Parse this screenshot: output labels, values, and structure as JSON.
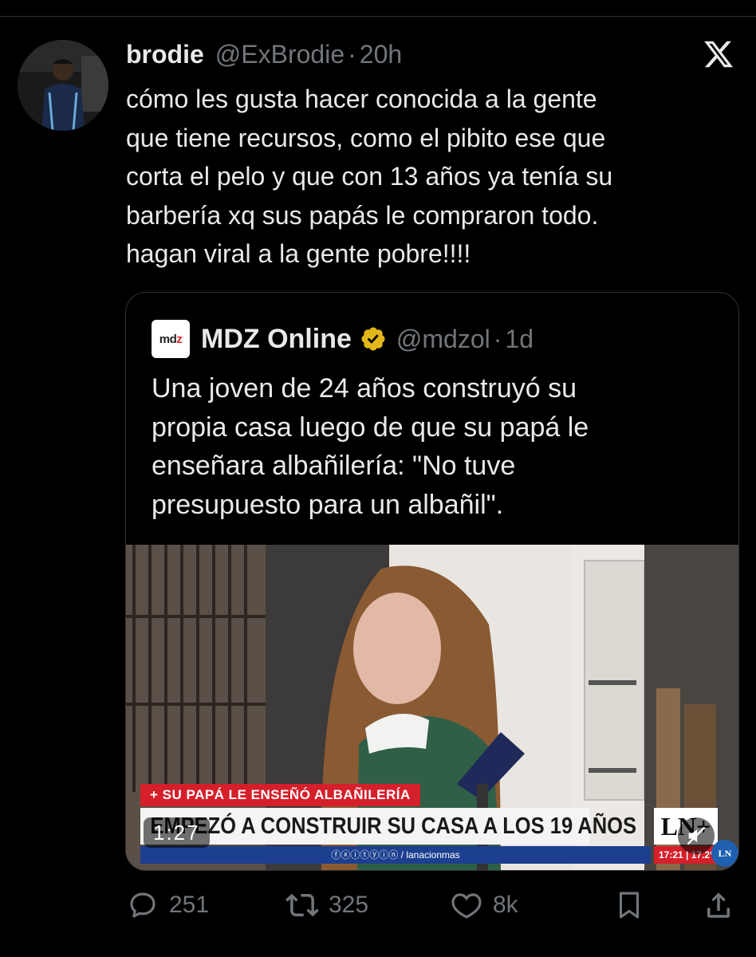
{
  "tweet": {
    "display_name": "brodie",
    "handle": "@ExBrodie",
    "separator": "·",
    "time": "20h",
    "text_lines": [
      "cómo les gusta hacer conocida a la gente",
      "que tiene recursos, como el pibito ese que",
      "corta el pelo y que con 13 años ya tenía su",
      "barbería xq sus papás le compraron todo.",
      "hagan viral a la gente pobre!!!!"
    ]
  },
  "quote": {
    "logo_text": "mdz",
    "display_name": "MDZ Online",
    "verified": "gold-verified-badge",
    "handle": "@mdzol",
    "separator": "·",
    "time": "1d",
    "text_lines": [
      "Una joven de 24 años construyó su",
      "propia casa luego de que su papá le",
      "enseñara albañilería: \"No tuve",
      "presupuesto para un albañil\"."
    ],
    "video": {
      "tag": "+ SU PAPÁ LE ENSEÑÓ ALBAÑILERÍA",
      "headline": "EMPEZÓ A CONSTRUIR SU CASA A LOS 19 AÑOS",
      "channel_badge": "LN+",
      "social_handle": "ⓕⓧⓘⓣⓨⓘⓝ / lanacionmas",
      "clock": "17:21 | 17.2°",
      "corner_logo": "LN",
      "duration": "1:27",
      "muted": true
    }
  },
  "actions": {
    "replies": "251",
    "reposts": "325",
    "likes": "8k"
  },
  "colors": {
    "background": "#000000",
    "text": "#e7e9ea",
    "muted": "#71767b",
    "border": "#2f3336",
    "verified_gold": "#e2b719",
    "news_red": "#d5202b"
  }
}
